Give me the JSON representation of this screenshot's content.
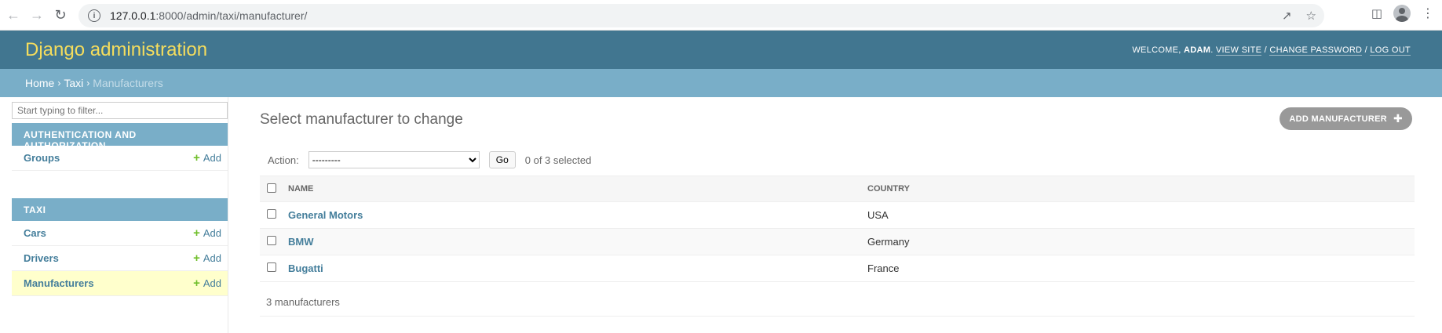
{
  "browser": {
    "url_host": "127.0.0.1",
    "url_rest": ":8000/admin/taxi/manufacturer/"
  },
  "header": {
    "title": "Django administration",
    "welcome": "Welcome,",
    "user": "adam",
    "view_site": "View site",
    "change_password": "Change password",
    "log_out": "Log out"
  },
  "breadcrumbs": {
    "home": "Home",
    "app": "Taxi",
    "current": "Manufacturers",
    "sep": "›"
  },
  "sidebar": {
    "filter_placeholder": "Start typing to filter...",
    "modules": [
      {
        "caption": "Authentication and Authorization",
        "rows": [
          {
            "model": "Groups",
            "add": "Add"
          }
        ]
      },
      {
        "caption": "Taxi",
        "rows": [
          {
            "model": "Cars",
            "add": "Add"
          },
          {
            "model": "Drivers",
            "add": "Add"
          },
          {
            "model": "Manufacturers",
            "add": "Add"
          }
        ]
      }
    ]
  },
  "main": {
    "title": "Select manufacturer to change",
    "add_button": "Add manufacturer",
    "action_label": "Action:",
    "action_selected": "---------",
    "go_label": "Go",
    "selected_count": "0 of 3 selected",
    "columns": [
      "Name",
      "Country"
    ],
    "rows": [
      {
        "name": "General Motors",
        "country": "USA"
      },
      {
        "name": "BMW",
        "country": "Germany"
      },
      {
        "name": "Bugatti",
        "country": "France"
      }
    ],
    "paginator": "3 manufacturers"
  },
  "colors": {
    "header_bg": "#417690",
    "breadcrumb_bg": "#79aec8",
    "branding": "#f5dd5d",
    "link": "#447e9b",
    "add_plus": "#70bf2b",
    "active_row": "#ffffcc"
  }
}
